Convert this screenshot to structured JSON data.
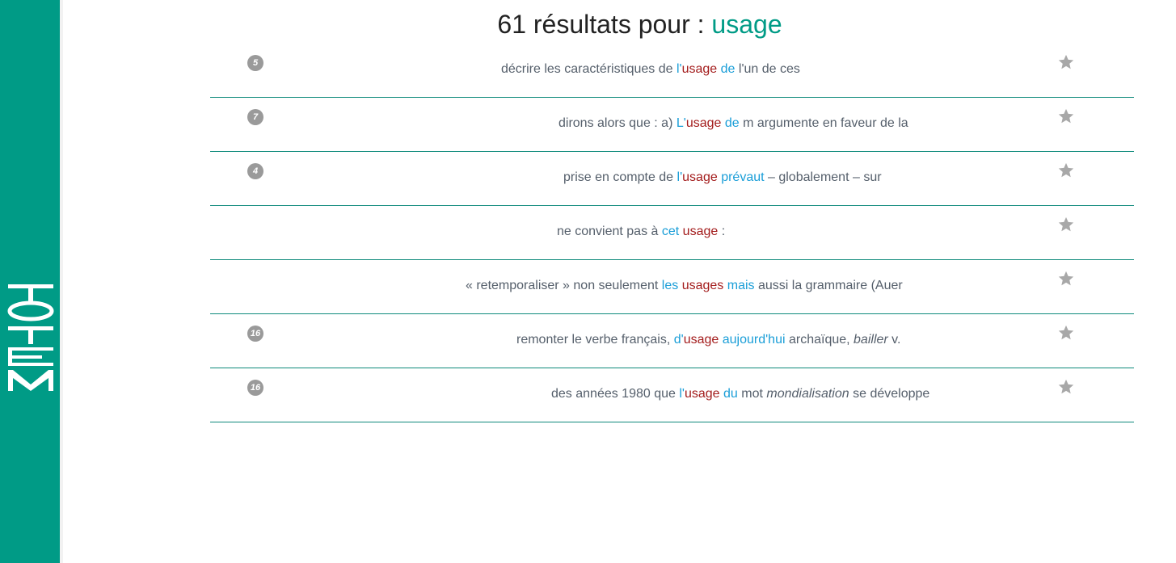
{
  "sidebar": {
    "logo_text": "TOTEM"
  },
  "header": {
    "title_prefix": "61 résultats pour : ",
    "query": "usage"
  },
  "colors": {
    "accent": "#009b86",
    "keyword": "#a31c1c",
    "collocate": "#1a9ed8",
    "divider": "#0e8a7b"
  },
  "results": [
    {
      "badge": "5",
      "segments": [
        {
          "t": "décrire les caractéristiques de ",
          "s": "plain"
        },
        {
          "t": "l'",
          "s": "col"
        },
        {
          "t": "usage",
          "s": "kw"
        },
        {
          "t": " ",
          "s": "plain"
        },
        {
          "t": "de",
          "s": "col"
        },
        {
          "t": " l'un de ces",
          "s": "plain"
        }
      ]
    },
    {
      "badge": "7",
      "segments": [
        {
          "t": "dirons alors que : a) ",
          "s": "plain"
        },
        {
          "t": "L'",
          "s": "col"
        },
        {
          "t": "usage",
          "s": "kw"
        },
        {
          "t": " ",
          "s": "plain"
        },
        {
          "t": "de",
          "s": "col"
        },
        {
          "t": " m argumente en faveur de la",
          "s": "plain"
        }
      ]
    },
    {
      "badge": "4",
      "segments": [
        {
          "t": "prise en compte de ",
          "s": "plain"
        },
        {
          "t": "l'",
          "s": "col"
        },
        {
          "t": "usage",
          "s": "kw"
        },
        {
          "t": " ",
          "s": "plain"
        },
        {
          "t": "prévaut",
          "s": "col"
        },
        {
          "t": " – globalement – sur",
          "s": "plain"
        }
      ]
    },
    {
      "badge": "",
      "segments": [
        {
          "t": "ne convient pas à ",
          "s": "plain"
        },
        {
          "t": "cet",
          "s": "col"
        },
        {
          "t": " ",
          "s": "plain"
        },
        {
          "t": "usage",
          "s": "kw"
        },
        {
          "t": " :",
          "s": "plain"
        }
      ]
    },
    {
      "badge": "",
      "segments": [
        {
          "t": "« retemporaliser » non seulement ",
          "s": "plain"
        },
        {
          "t": "les",
          "s": "col"
        },
        {
          "t": " ",
          "s": "plain"
        },
        {
          "t": "usages",
          "s": "kw"
        },
        {
          "t": " ",
          "s": "plain"
        },
        {
          "t": "mais",
          "s": "col"
        },
        {
          "t": " aussi la grammaire (Auer",
          "s": "plain"
        }
      ]
    },
    {
      "badge": "16",
      "segments": [
        {
          "t": "remonter le verbe français, ",
          "s": "plain"
        },
        {
          "t": "d'",
          "s": "col"
        },
        {
          "t": "usage",
          "s": "kw"
        },
        {
          "t": " ",
          "s": "plain"
        },
        {
          "t": "aujourd'hui",
          "s": "col"
        },
        {
          "t": " archaïque, ",
          "s": "plain"
        },
        {
          "t": "bailler",
          "s": "ital"
        },
        {
          "t": " v.",
          "s": "plain"
        }
      ]
    },
    {
      "badge": "16",
      "segments": [
        {
          "t": "des années 1980 que ",
          "s": "plain"
        },
        {
          "t": "l'",
          "s": "col"
        },
        {
          "t": "usage",
          "s": "kw"
        },
        {
          "t": " ",
          "s": "plain"
        },
        {
          "t": "du",
          "s": "col"
        },
        {
          "t": " mot ",
          "s": "plain"
        },
        {
          "t": "mondialisation",
          "s": "ital"
        },
        {
          "t": " se développe",
          "s": "plain"
        }
      ]
    }
  ]
}
